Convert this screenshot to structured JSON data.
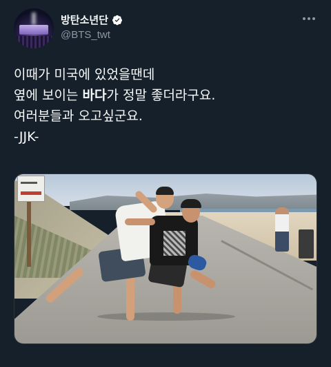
{
  "header": {
    "display_name": "방탄소년단",
    "handle": "@BTS_twt",
    "verified": true,
    "more_icon": "more-horizontal-icon"
  },
  "tweet": {
    "lines": [
      "이때가 미국에 있었을땐데",
      "옆에 보이는 ",
      "바다",
      "가 정말 좋더라구요.",
      "여러분들과 오고싶군요.",
      "-JJK-"
    ]
  },
  "media": {
    "type": "photo"
  },
  "colors": {
    "background": "#15202b",
    "text": "#f7f9f9",
    "secondary": "#8b98a5",
    "verified": "#ffffff"
  }
}
